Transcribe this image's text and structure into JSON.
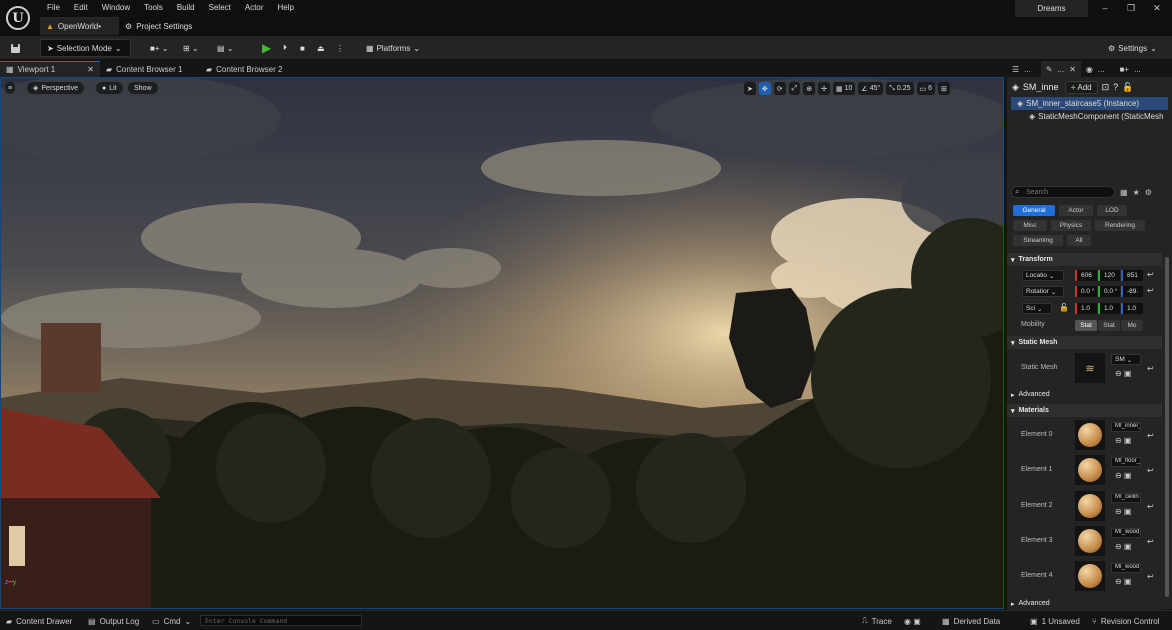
{
  "menu": [
    "File",
    "Edit",
    "Window",
    "Tools",
    "Build",
    "Select",
    "Actor",
    "Help"
  ],
  "doc_tabs": [
    "OpenWorld•",
    "Project Settings"
  ],
  "project_name": "Dreams",
  "window_controls": {
    "minimize": "–",
    "maximize": "❐",
    "close": "✕"
  },
  "toolbar": {
    "selection_mode": "Selection Mode",
    "platforms": "Platforms",
    "settings": "Settings"
  },
  "panel_tabs": [
    "Viewport 1",
    "Content Browser 1",
    "Content Browser 2"
  ],
  "viewport": {
    "perspective": "Perspective",
    "lit": "Lit",
    "show": "Show",
    "grid_snap": "10",
    "rot_snap": "45°",
    "scale_snap": "0.25",
    "camera_speed": "6",
    "axes": {
      "z": "z",
      "y": "y"
    }
  },
  "details": {
    "tabs": [
      "...",
      "...",
      "...",
      "..."
    ],
    "actor_name": "SM_inne",
    "add_label": "Add",
    "tree": [
      "SM_inner_staircase5 (Instance)",
      "StaticMeshComponent (StaticMesh"
    ],
    "search_placeholder": "Search",
    "filters": [
      "General",
      "Actor",
      "LOD",
      "Misc",
      "Physics",
      "Rendering",
      "Streaming",
      "All"
    ],
    "sections": {
      "transform": "Transform",
      "static_mesh": "Static Mesh",
      "advanced": "Advanced",
      "materials": "Materials",
      "advanced2": "Advanced"
    },
    "transform": {
      "location_label": "Locatio",
      "location": [
        "606",
        "120",
        "851"
      ],
      "rotation_label": "Rotatior",
      "rotation": [
        "0.0 °",
        "0.0 °",
        "-89."
      ],
      "scale_label": "Sci",
      "scale": [
        "1.0",
        "1.0",
        "1.0"
      ],
      "mobility_label": "Mobility",
      "mobility": [
        "Stat",
        "Stat",
        "Mo"
      ]
    },
    "static_mesh": {
      "label": "Static Mesh",
      "value": "SM"
    },
    "materials": [
      {
        "label": "Element 0",
        "name": "MI_inner_"
      },
      {
        "label": "Element 1",
        "name": "MI_floor_"
      },
      {
        "label": "Element 2",
        "name": "MI_ceilin"
      },
      {
        "label": "Element 3",
        "name": "MI_wood"
      },
      {
        "label": "Element 4",
        "name": "MI_wood"
      }
    ]
  },
  "statusbar": {
    "content_drawer": "Content Drawer",
    "output_log": "Output Log",
    "cmd": "Cmd",
    "console_placeholder": "Enter Console Command",
    "trace": "Trace",
    "derived_data": "Derived Data",
    "unsaved": "1 Unsaved",
    "revision": "Revision Control"
  }
}
